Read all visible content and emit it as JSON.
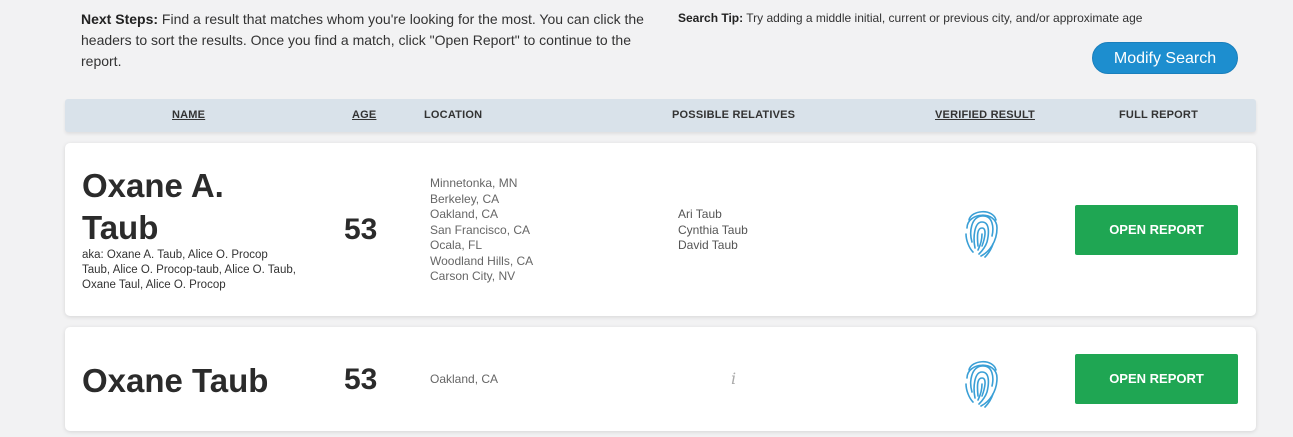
{
  "instructions": {
    "next_steps_label": "Next Steps:",
    "next_steps_text": " Find a result that matches whom you're looking for the most. You can click the headers to sort the results. Once you find a match, click \"Open Report\" to continue to the report.",
    "tip_label": "Search Tip:",
    "tip_text": " Try adding a middle initial, current or previous city, and/or approximate age"
  },
  "modify_button": "Modify Search",
  "headers": {
    "name": "NAME",
    "age": "AGE",
    "location": "LOCATION",
    "relatives": "POSSIBLE RELATIVES",
    "verified": "VERIFIED RESULT",
    "report": "FULL REPORT"
  },
  "results": [
    {
      "name_line1": "Oxane A.",
      "name_line2": "Taub",
      "aka": "aka: Oxane A. Taub, Alice O. Procop Taub, Alice O. Procop-taub, Alice O. Taub, Oxane Taul, Alice O. Procop",
      "age": "53",
      "locations": [
        "Minnetonka, MN",
        "Berkeley, CA",
        "Oakland, CA",
        "San Francisco, CA",
        "Ocala, FL",
        "Woodland Hills, CA",
        "Carson City, NV"
      ],
      "relatives": [
        "Ari Taub",
        "Cynthia Taub",
        "David Taub"
      ],
      "verified_icon": "fingerprint-icon",
      "button": "OPEN REPORT"
    },
    {
      "name": "Oxane Taub",
      "age": "53",
      "locations": [
        "Oakland, CA"
      ],
      "relatives_icon": "info-icon",
      "relatives_glyph": "i",
      "verified_icon": "fingerprint-icon",
      "button": "OPEN REPORT"
    }
  ],
  "colors": {
    "accent_blue": "#1d8ecf",
    "button_green": "#1fa653",
    "header_bg": "#d9e2ea",
    "fingerprint": "#3a9fd6"
  }
}
